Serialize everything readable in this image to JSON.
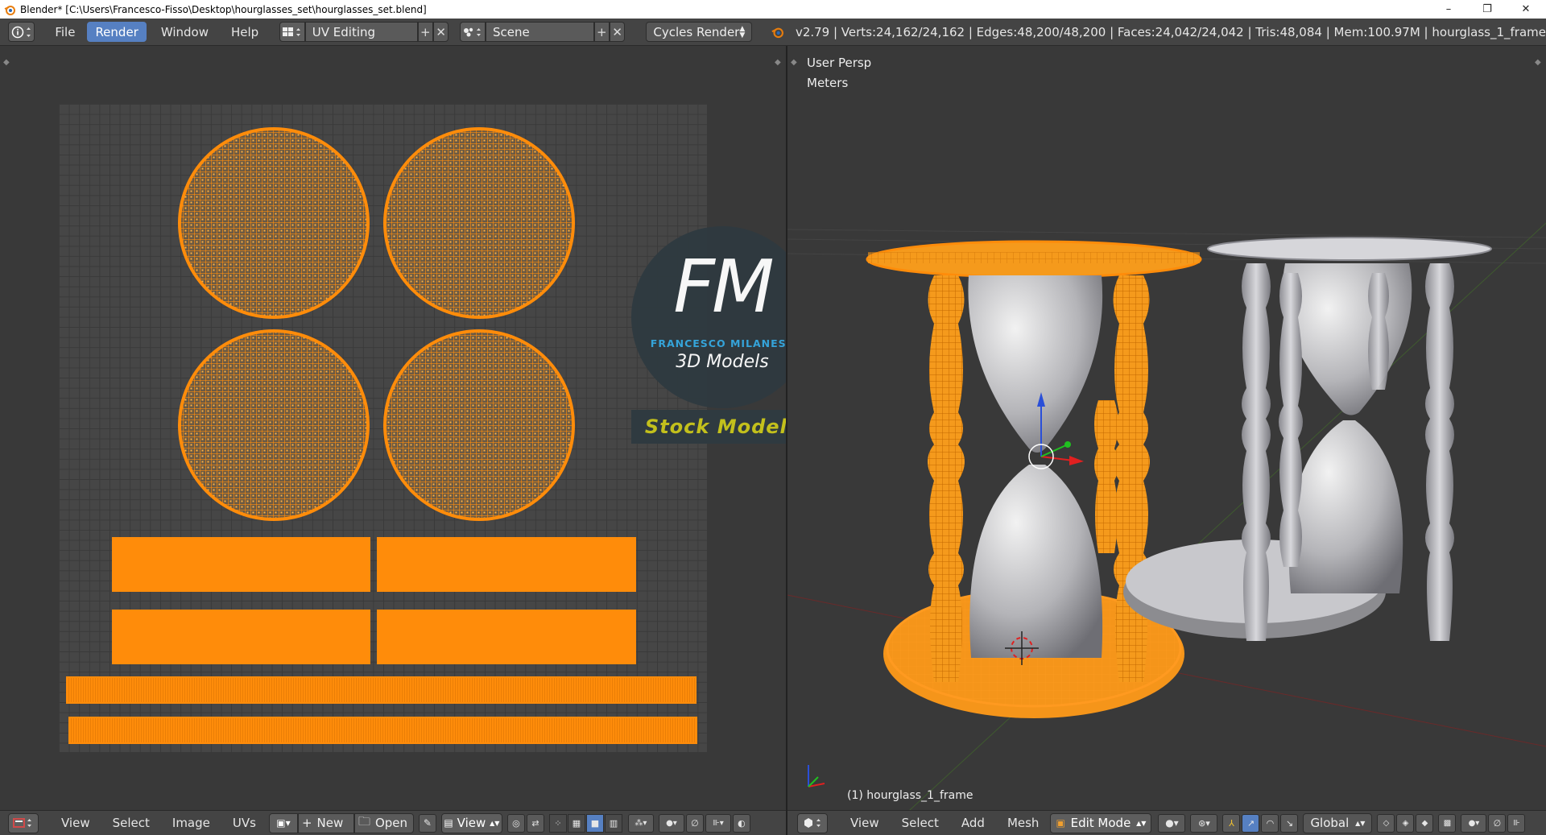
{
  "window": {
    "title": "Blender* [C:\\Users\\Francesco-Fisso\\Desktop\\hourglasses_set\\hourglasses_set.blend]",
    "minimize": "–",
    "maximize": "❐",
    "close": "✕"
  },
  "info_header": {
    "menus": [
      "File",
      "Render",
      "Window",
      "Help"
    ],
    "active_menu": "Render",
    "screen_layout": "UV Editing",
    "scene": "Scene",
    "render_engine": "Cycles Render",
    "stats": "v2.79 | Verts:24,162/24,162 | Edges:48,200/48,200 | Faces:24,042/24,042 | Tris:48,084 | Mem:100.97M | hourglass_1_frame"
  },
  "viewport": {
    "view_name": "User Persp",
    "units": "Meters",
    "object_label": "(1) hourglass_1_frame"
  },
  "watermark": {
    "logo_letters": "FM",
    "brand": "FRANCESCO MILANESE",
    "sub": "3D Models",
    "tag": "Stock Models"
  },
  "uv_footer": {
    "menus": [
      "View",
      "Select",
      "Image",
      "UVs"
    ],
    "new_label": "New",
    "open_label": "Open",
    "view_label": "View"
  },
  "vp_footer": {
    "menus": [
      "View",
      "Select",
      "Add",
      "Mesh"
    ],
    "mode": "Edit Mode",
    "orientation": "Global"
  },
  "colors": {
    "uv_orange": "#ff8c0a",
    "active_blue": "#5680c2",
    "panel": "#444444",
    "background": "#393939"
  }
}
